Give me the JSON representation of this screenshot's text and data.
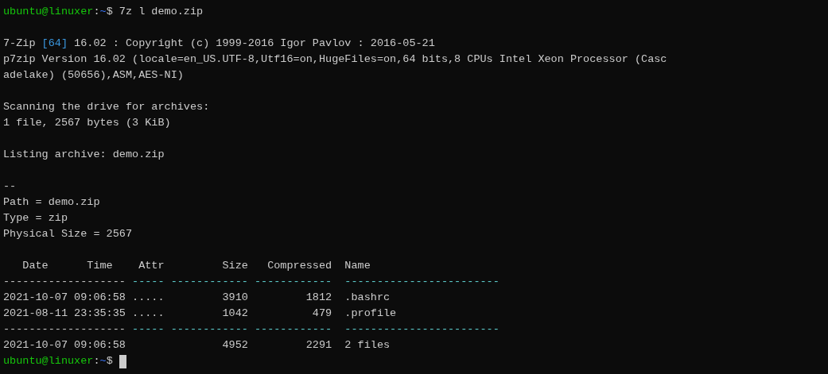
{
  "terminal": {
    "lines": [
      {
        "kind": "text",
        "segments": [
          {
            "kind": "user",
            "text": "ubuntu@linuxer"
          },
          {
            "kind": "plain",
            "text": ":"
          },
          {
            "kind": "path",
            "text": "~"
          },
          {
            "kind": "plain",
            "text": "$ 7z l demo.zip"
          }
        ]
      },
      {
        "kind": "blank"
      },
      {
        "kind": "text",
        "segments": [
          {
            "kind": "plain",
            "text": "7-Zip "
          },
          {
            "kind": "accent",
            "text": "[64]"
          },
          {
            "kind": "plain",
            "text": " 16.02 : Copyright (c) 1999-2016 Igor Pavlov : 2016-05-21"
          }
        ]
      },
      {
        "kind": "text",
        "segments": [
          {
            "kind": "plain",
            "text": "p7zip Version 16.02 (locale=en_US.UTF-8,Utf16=on,HugeFiles=on,64 bits,8 CPUs Intel Xeon Processor (Casc"
          }
        ]
      },
      {
        "kind": "text",
        "segments": [
          {
            "kind": "plain",
            "text": "adelake) (50656),ASM,AES-NI)"
          }
        ]
      },
      {
        "kind": "blank"
      },
      {
        "kind": "text",
        "segments": [
          {
            "kind": "plain",
            "text": "Scanning the drive for archives:"
          }
        ]
      },
      {
        "kind": "text",
        "segments": [
          {
            "kind": "plain",
            "text": "1 file, 2567 bytes (3 KiB)"
          }
        ]
      },
      {
        "kind": "blank"
      },
      {
        "kind": "text",
        "segments": [
          {
            "kind": "plain",
            "text": "Listing archive: demo.zip"
          }
        ]
      },
      {
        "kind": "blank"
      },
      {
        "kind": "text",
        "segments": [
          {
            "kind": "plain",
            "text": "--"
          }
        ]
      },
      {
        "kind": "text",
        "segments": [
          {
            "kind": "plain",
            "text": "Path = demo.zip"
          }
        ]
      },
      {
        "kind": "text",
        "segments": [
          {
            "kind": "plain",
            "text": "Type = zip"
          }
        ]
      },
      {
        "kind": "text",
        "segments": [
          {
            "kind": "plain",
            "text": "Physical Size = 2567"
          }
        ]
      },
      {
        "kind": "blank"
      },
      {
        "kind": "text",
        "segments": [
          {
            "kind": "plain",
            "text": "   Date      Time    Attr         Size   Compressed  Name"
          }
        ]
      },
      {
        "kind": "text",
        "segments": [
          {
            "kind": "plain",
            "text": "------------------- "
          },
          {
            "kind": "rule",
            "text": "----- ------------ ------------  ------------------------"
          }
        ]
      },
      {
        "kind": "text",
        "segments": [
          {
            "kind": "plain",
            "text": "2021-10-07 09:06:58 .....         3910         1812  .bashrc"
          }
        ]
      },
      {
        "kind": "text",
        "segments": [
          {
            "kind": "plain",
            "text": "2021-08-11 23:35:35 .....         1042          479  .profile"
          }
        ]
      },
      {
        "kind": "text",
        "segments": [
          {
            "kind": "plain",
            "text": "------------------- "
          },
          {
            "kind": "rule",
            "text": "----- ------------ ------------  ------------------------"
          }
        ]
      },
      {
        "kind": "text",
        "segments": [
          {
            "kind": "plain",
            "text": "2021-10-07 09:06:58               4952         2291  2 files"
          }
        ]
      },
      {
        "kind": "text",
        "cursor": true,
        "segments": [
          {
            "kind": "user",
            "text": "ubuntu@linuxer"
          },
          {
            "kind": "plain",
            "text": ":"
          },
          {
            "kind": "path",
            "text": "~"
          },
          {
            "kind": "plain",
            "text": "$ "
          }
        ]
      }
    ]
  }
}
